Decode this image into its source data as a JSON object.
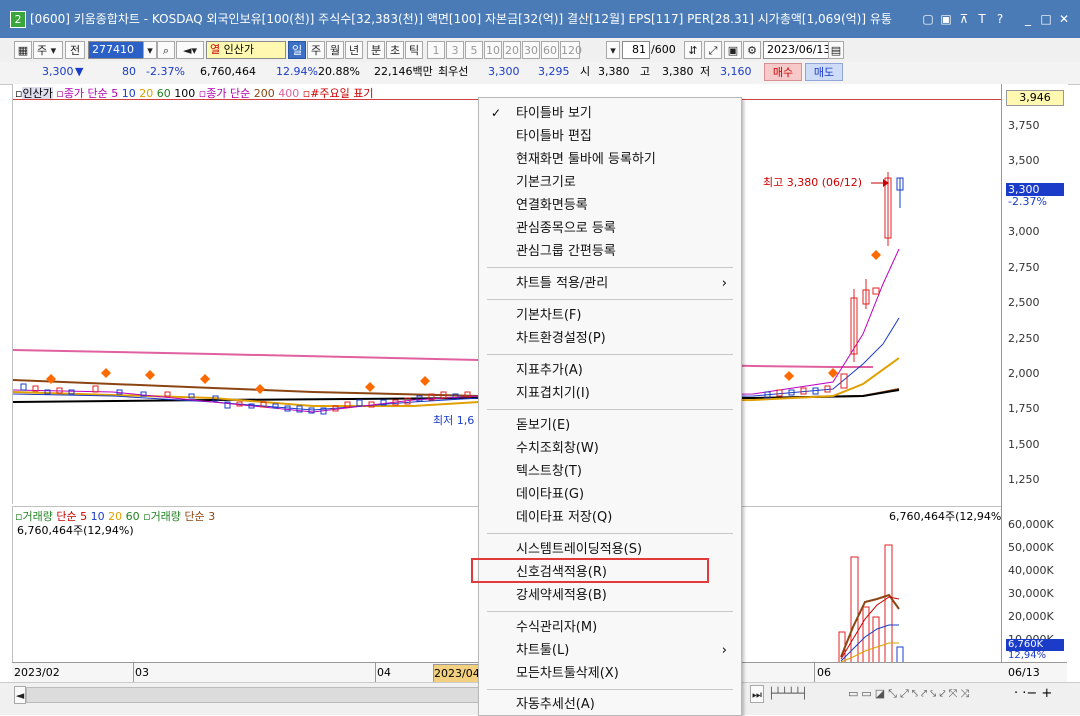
{
  "window": {
    "badge": "2",
    "title": "[0600] 키움종합차트 - KOSDAQ 외국인보유[100(천)] 주식수[32,383(천)] 액면[100] 자본금[32(억)] 결산[12월] EPS[117] PER[28.31] 시가총액[1,069(억)] 유통",
    "buttons": [
      "▢",
      "▣",
      "⊼",
      "T",
      "?",
      "_",
      "□",
      "✕"
    ]
  },
  "toolbar": {
    "mode1": "주",
    "mode2": "전",
    "code": "277410",
    "name": "인산가",
    "periods": [
      "일",
      "주",
      "월",
      "년",
      "분",
      "초",
      "틱"
    ],
    "active_period": "일",
    "intervals": [
      "1",
      "3",
      "5",
      "10",
      "20",
      "30",
      "60",
      "120"
    ],
    "count": "81",
    "count_total": "/600",
    "date": "2023/06/13"
  },
  "quote": {
    "price": "3,300",
    "down_arrow": "▼",
    "change": "80",
    "change_pct": "-2.37%",
    "volume": "6,760,464",
    "vol_pct1": "12.94%",
    "vol_pct2": "20.88%",
    "amount": "22,146백만",
    "best_label": "최우선",
    "best_ask": "3,300",
    "best_bid": "3,295",
    "open_label": "시",
    "open": "3,380",
    "high_label": "고",
    "high": "3,380",
    "low_label": "저",
    "low": "3,160",
    "buy": "매수",
    "sell": "매도"
  },
  "legend_price": {
    "name": "인산가",
    "ma_label": "종가 단순",
    "ma_periods": [
      "5",
      "10",
      "20",
      "60",
      "100"
    ],
    "ma2_label": "종가 단순",
    "ma2_periods": [
      "200",
      "400"
    ],
    "extra": "#주요일 표기"
  },
  "legend_vol": {
    "name": "거래량",
    "ma_label": "단순",
    "periods": [
      "5",
      "10",
      "20",
      "60"
    ],
    "name2": "거래량",
    "ma2_label": "단순",
    "period2": "3",
    "value": "6,760,464주(12,94%)",
    "value_right": "6,760,464주(12,94%)"
  },
  "annotations": {
    "high": "최고 3,380 (06/12)",
    "low": "최저 1,6"
  },
  "yaxis": {
    "price_ticks": [
      "3,946",
      "3,750",
      "3,500",
      "3,300",
      "3,000",
      "2,750",
      "2,500",
      "2,250",
      "2,000",
      "1,750",
      "1,500",
      "1,250"
    ],
    "current": "3,300",
    "current_pct": "-2.37%",
    "top_label": "3,946",
    "vol_ticks": [
      "60,000K",
      "50,000K",
      "40,000K",
      "30,000K",
      "20,000K",
      "10,000K"
    ],
    "vol_current": "6,760K",
    "vol_pct": "12,94%"
  },
  "xaxis": {
    "labels": [
      "2023/02",
      "03",
      "04",
      "2023/04",
      "06",
      "06/13"
    ]
  },
  "context_menu": {
    "items": [
      {
        "label": "타이틀바 보기",
        "checked": true
      },
      {
        "label": "타이틀바 편집"
      },
      {
        "label": "현재화면 툴바에 등록하기"
      },
      {
        "label": "기본크기로"
      },
      {
        "label": "연결화면등록"
      },
      {
        "label": "관심종목으로 등록"
      },
      {
        "label": "관심그룹 간편등록"
      },
      {
        "label": "차트틀 적용/관리",
        "submenu": true
      },
      {
        "label": "기본차트(F)"
      },
      {
        "label": "차트환경설정(P)"
      },
      {
        "label": "지표추가(A)"
      },
      {
        "label": "지표겹치기(I)"
      },
      {
        "label": "돋보기(E)"
      },
      {
        "label": "수치조회창(W)"
      },
      {
        "label": "텍스트창(T)"
      },
      {
        "label": "데이타표(G)"
      },
      {
        "label": "데이타표 저장(Q)"
      },
      {
        "label": "시스템트레이딩적용(S)"
      },
      {
        "label": "신호검색적용(R)",
        "highlighted": true
      },
      {
        "label": "강세약세적용(B)"
      },
      {
        "label": "수식관리자(M)"
      },
      {
        "label": "차트툴(L)",
        "submenu": true
      },
      {
        "label": "모든차트툴삭제(X)"
      },
      {
        "label": "자동추세선(A)"
      }
    ],
    "check_mark": "✓",
    "submenu_arrow": "›"
  },
  "colors": {
    "titlebar": "#4a7bb6",
    "up": "#e02020",
    "down": "#1a3cc8",
    "highlight_box": "#e03a3a",
    "marker": "#ff6a00"
  }
}
